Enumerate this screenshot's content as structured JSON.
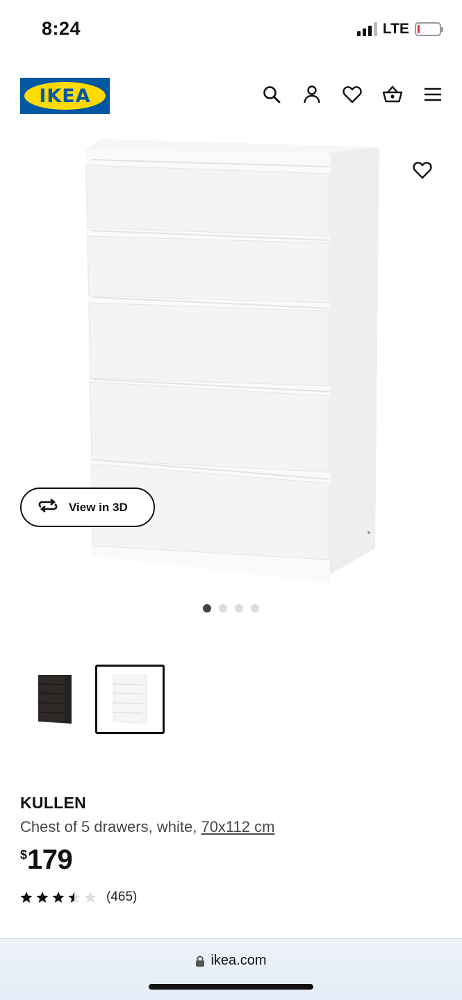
{
  "status_bar": {
    "time": "8:24",
    "network": "LTE",
    "battery_color": "#e0322d"
  },
  "header": {
    "logo_text": "IKEA",
    "brand_colors": {
      "blue": "#0058a3",
      "yellow": "#ffdb00"
    },
    "icons": [
      "search-icon",
      "account-icon",
      "heart-icon",
      "basket-icon",
      "menu-icon"
    ]
  },
  "gallery": {
    "view_3d_label": "View in 3D",
    "active_slide": 1,
    "slide_count": 4
  },
  "thumbnails": [
    {
      "variant": "black-brown",
      "selected": false
    },
    {
      "variant": "white",
      "selected": true
    }
  ],
  "product": {
    "name": "KULLEN",
    "description": "Chest of 5 drawers, white, ",
    "size": "70x112 cm",
    "currency_symbol": "$",
    "price": "179",
    "rating": 3.5,
    "rating_max": 5,
    "review_count": "(465)"
  },
  "browser": {
    "url": "ikea.com"
  }
}
